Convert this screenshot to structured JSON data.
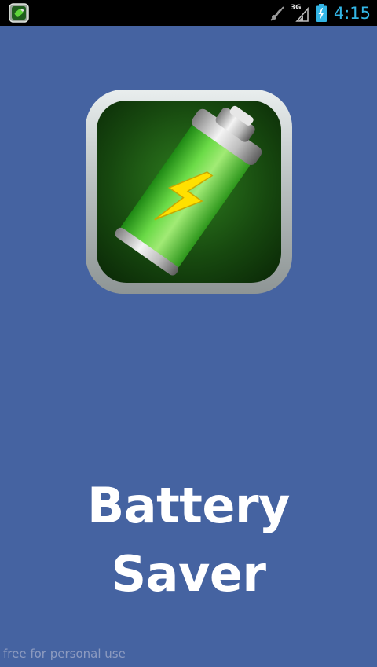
{
  "status_bar": {
    "network_label": "3G",
    "time": "4:15",
    "icons": [
      "app-notification-icon",
      "mute-icon",
      "signal-3g-icon",
      "battery-charging-icon"
    ]
  },
  "splash": {
    "icon": "battery-saver-app-icon",
    "title_line1": "Battery",
    "title_line2": "Saver"
  },
  "watermark": "free for personal use",
  "colors": {
    "background": "#4563a1",
    "status_bar": "#000000",
    "clock": "#33b5e5",
    "title": "#ffffff"
  }
}
